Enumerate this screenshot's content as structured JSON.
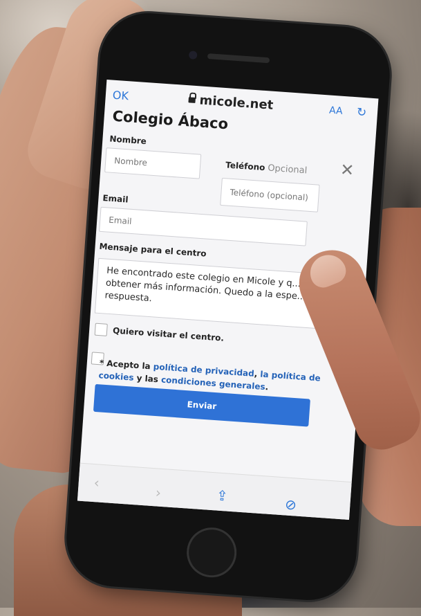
{
  "browser": {
    "ok_label": "OK",
    "url": "micole.net",
    "text_size_label": "AA",
    "reload_icon": "reload-icon",
    "toolbar_icons": [
      "back-icon",
      "forward-icon",
      "share-icon",
      "compass-icon"
    ]
  },
  "form": {
    "title": "Colegio Ábaco",
    "close_icon": "close-icon",
    "name": {
      "label": "Nombre",
      "placeholder": "Nombre"
    },
    "phone": {
      "label": "Teléfono",
      "optional": "Opcional",
      "placeholder": "Teléfono (opcional)"
    },
    "email": {
      "label": "Email",
      "placeholder": "Email"
    },
    "message": {
      "label": "Mensaje para el centro",
      "value": "He encontrado este colegio en Micole y q... obtener más información. Quedo a la espe... respuesta."
    },
    "visit_checkbox": {
      "label": "Quiero visitar el centro.",
      "checked": false
    },
    "privacy": {
      "checked": false,
      "prefix": "* Acepto la ",
      "link1": "política de privacidad",
      "sep1": ", ",
      "link2": "la política de cookies",
      "sep2": " y las ",
      "link3": "condiciones generales",
      "suffix": "."
    },
    "submit_label": "Enviar"
  },
  "colors": {
    "accent": "#2f72d6",
    "link": "#2563b8"
  }
}
